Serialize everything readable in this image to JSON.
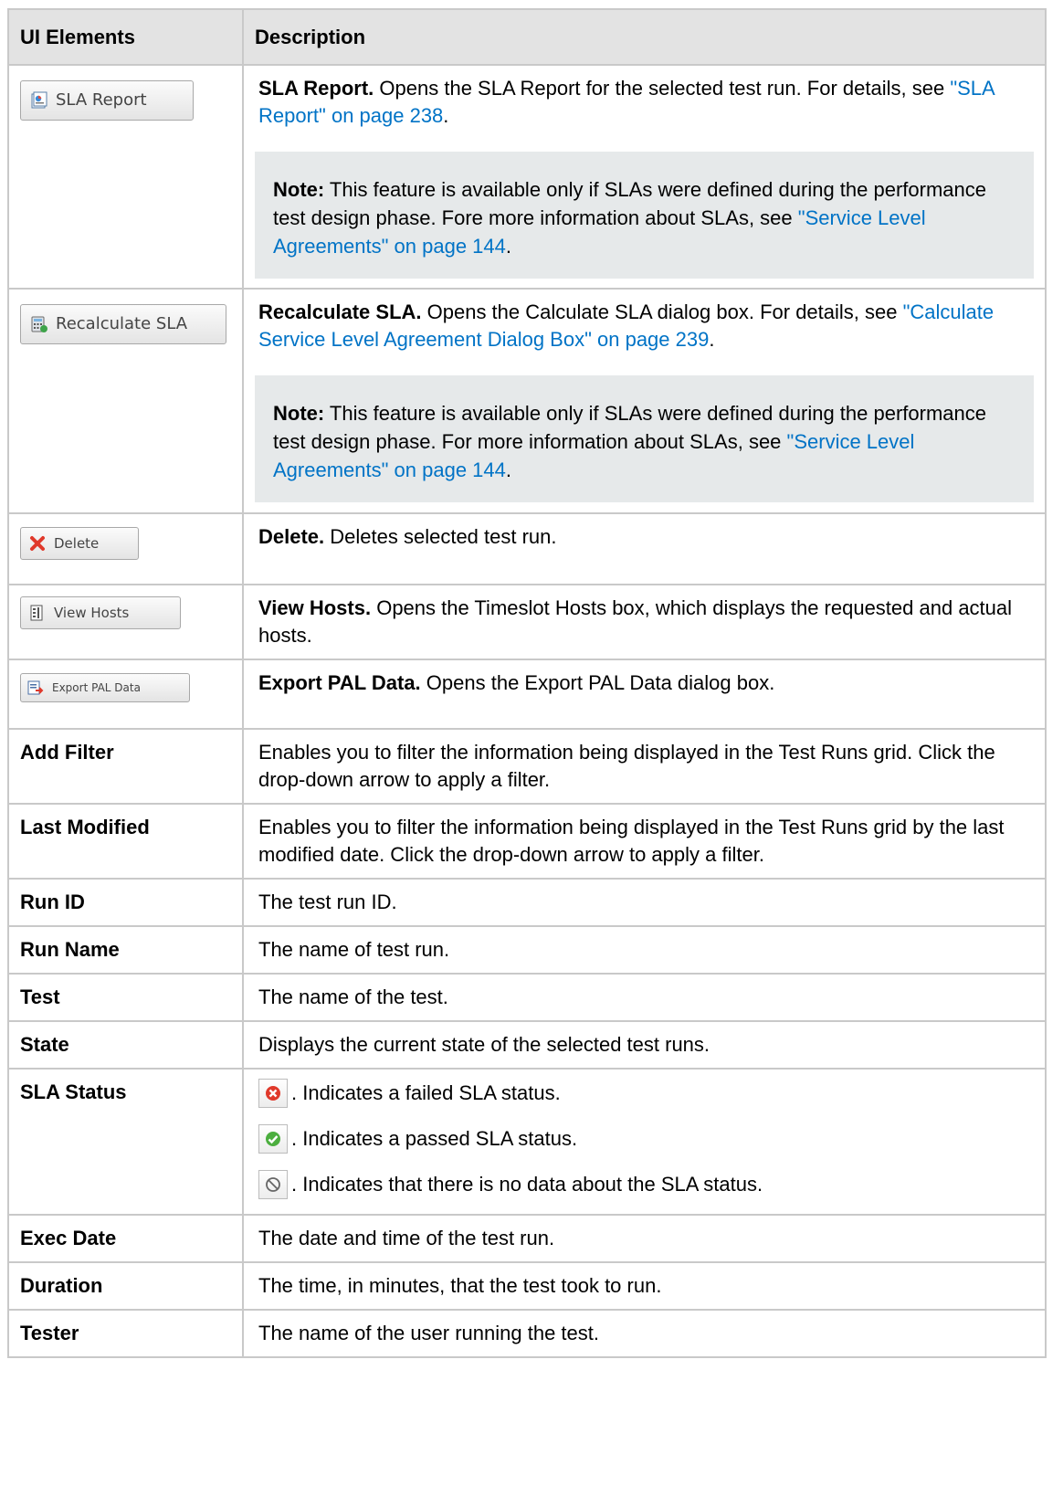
{
  "header": {
    "col1": "UI Elements",
    "col2": "Description"
  },
  "rows": [
    {
      "button": {
        "label": "SLA Report",
        "icon": "report-icon"
      },
      "lead": "SLA Report.",
      "text": " Opens the SLA Report for the selected test run. For details, see ",
      "link": "\"SLA Report\" on page 238",
      "tail": ".",
      "note": {
        "label": "Note:",
        "text": " This feature is available only if SLAs were defined during the performance test design phase. Fore more information about SLAs, see ",
        "link": "\"Service Level Agreements\" on page 144",
        "tail": "."
      }
    },
    {
      "button": {
        "label": "Recalculate SLA",
        "icon": "calculator-icon"
      },
      "lead": "Recalculate SLA.",
      "text": " Opens the Calculate SLA dialog box. For details, see ",
      "link": "\"Calculate Service Level Agreement Dialog Box\" on page 239",
      "tail": ".",
      "note": {
        "label": "Note:",
        "text": " This feature is available only if SLAs were defined during the performance test design phase. For more information about SLAs, see ",
        "link": "\"Service Level Agreements\" on page 144",
        "tail": "."
      }
    },
    {
      "button": {
        "label": "Delete",
        "icon": "delete-x-icon"
      },
      "lead": "Delete.",
      "text": " Deletes selected test run."
    },
    {
      "button": {
        "label": "View Hosts",
        "icon": "hosts-list-icon"
      },
      "lead": "View Hosts.",
      "text": " Opens the Timeslot Hosts box, which displays the requested and actual hosts."
    },
    {
      "button": {
        "label": "Export PAL Data",
        "icon": "export-icon"
      },
      "lead": "Export PAL Data.",
      "text": " Opens the Export PAL Data dialog box."
    }
  ],
  "fields": [
    {
      "label": "Add Filter",
      "text": "Enables you to filter the information being displayed in the Test Runs grid. Click the drop-down arrow to apply a filter."
    },
    {
      "label": "Last Modified",
      "text": "Enables you to filter the information being displayed in the Test Runs grid by the last modified date. Click the drop-down arrow to apply a filter."
    },
    {
      "label": "Run ID",
      "text": "The test run ID."
    },
    {
      "label": "Run Name",
      "text": "The name of test run."
    },
    {
      "label": "Test",
      "text": "The name of the test."
    },
    {
      "label": "State",
      "text": "Displays the current state of the selected test runs."
    }
  ],
  "sla_status": {
    "label": "SLA Status",
    "items": [
      {
        "icon": "failed-status-icon",
        "text": ". Indicates a failed SLA status."
      },
      {
        "icon": "passed-status-icon",
        "text": ". Indicates a passed SLA status."
      },
      {
        "icon": "no-data-status-icon",
        "text": ". Indicates that there is no data about the SLA status."
      }
    ]
  },
  "fields2": [
    {
      "label": "Exec Date",
      "text": "The date and time of the test run."
    },
    {
      "label": "Duration",
      "text": "The time, in minutes, that the test took to run."
    },
    {
      "label": "Tester",
      "text": "The name of the user running the test."
    }
  ],
  "colors": {
    "link": "#0073c6",
    "note_bg": "#e6e9ea",
    "header_bg": "#e3e3e3",
    "border": "#c9c9c9"
  }
}
